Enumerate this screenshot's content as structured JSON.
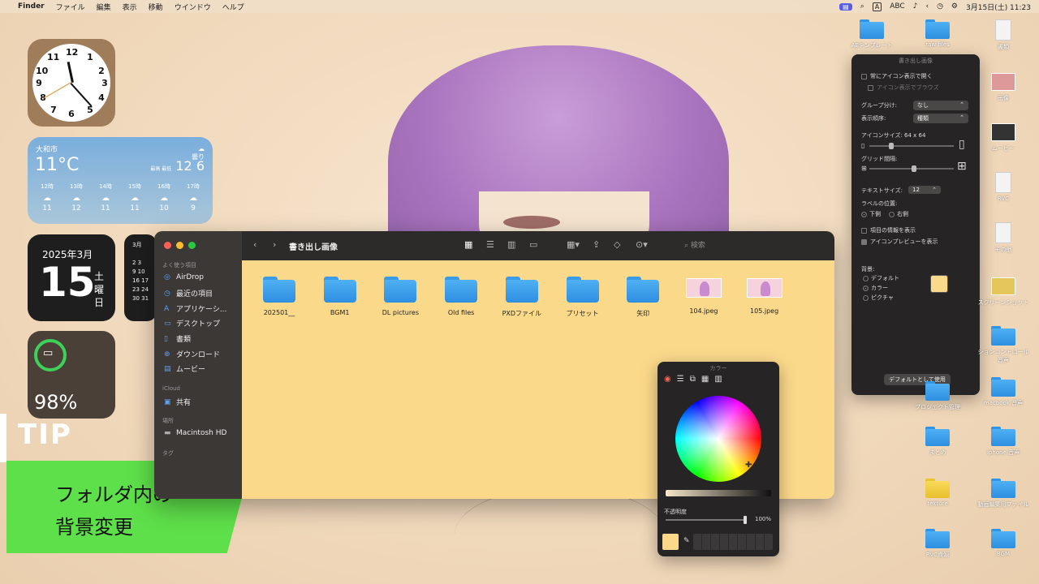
{
  "menubar": {
    "app": "Finder",
    "items": [
      "ファイル",
      "編集",
      "表示",
      "移動",
      "ウインドウ",
      "ヘルプ"
    ],
    "input_abc": "ABC",
    "input_a": "A",
    "datetime": "3月15日(土) 11:23"
  },
  "weather": {
    "city": "大和市",
    "temp": "11°C",
    "cond": "曇り",
    "hilo_label": "最高 最低",
    "hilo": "12 6",
    "hours": [
      {
        "h": "12時",
        "t": "11"
      },
      {
        "h": "13時",
        "t": "12"
      },
      {
        "h": "14時",
        "t": "11"
      },
      {
        "h": "15時",
        "t": "11"
      },
      {
        "h": "16時",
        "t": "10"
      },
      {
        "h": "17時",
        "t": "9"
      }
    ]
  },
  "date_widget": {
    "ym": "2025年3月",
    "day": "15",
    "weekday": "土曜日"
  },
  "cal_widget": {
    "month": "3月",
    "rows": [
      "",
      "2 3",
      "9 10",
      "16 17",
      "23 24",
      "30 31"
    ]
  },
  "battery": {
    "pct": "98%",
    "level": 0.98
  },
  "tip": {
    "label": "TIP",
    "line1": "フォルダ内の",
    "line2": "背景変更"
  },
  "finder": {
    "title": "書き出し画像",
    "search_placeholder": "検索",
    "sidebar": {
      "favorites_header": "よく使う項目",
      "favorites": [
        "AirDrop",
        "最近の項目",
        "アプリケーシ...",
        "デスクトップ",
        "書類",
        "ダウンロード",
        "ムービー"
      ],
      "icloud_header": "iCloud",
      "icloud": [
        "共有"
      ],
      "locations_header": "場所",
      "locations": [
        "Macintosh HD"
      ],
      "tags_header": "タグ"
    },
    "items": [
      {
        "name": "202501__",
        "kind": "folder"
      },
      {
        "name": "BGM1",
        "kind": "folder"
      },
      {
        "name": "DL pictures",
        "kind": "folder"
      },
      {
        "name": "Old files",
        "kind": "folder"
      },
      {
        "name": "PXDファイル",
        "kind": "folder"
      },
      {
        "name": "プリセット",
        "kind": "folder"
      },
      {
        "name": "矢印",
        "kind": "folder"
      },
      {
        "name": "104.jpeg",
        "kind": "image"
      },
      {
        "name": "105.jpeg",
        "kind": "image"
      }
    ],
    "bg_color": "#fbd98b"
  },
  "view_options": {
    "title": "書き出し画像",
    "always_icon": "常にアイコン表示で開く",
    "browse_icon": "アイコン表示でブラウズ",
    "group_label": "グループ分け:",
    "group_value": "なし",
    "sort_label": "表示順序:",
    "sort_value": "種類",
    "icon_size_label": "アイコンサイズ: 64 x 64",
    "grid_label": "グリッド間隔:",
    "text_size_label": "テキストサイズ:",
    "text_size_value": "12",
    "label_pos": "ラベルの位置:",
    "pos_bottom": "下側",
    "pos_right": "右側",
    "show_info": "項目の情報を表示",
    "show_preview": "アイコンプレビューを表示",
    "bg_label": "背景:",
    "bg_default": "デフォルト",
    "bg_color": "カラー",
    "bg_picture": "ピクチャ",
    "default_btn": "デフォルトとして使用"
  },
  "color_panel": {
    "title": "カラー",
    "opacity_label": "不透明度",
    "opacity_value": "100%"
  },
  "desktop": {
    "col1": [
      "AEテンプレート",
      "プロジェクト管理",
      "まとめ",
      "texture",
      "RVC資源"
    ],
    "col2": [
      "raw files",
      "macbook 音声",
      "iphone 音声",
      "動画編集用ファイル",
      "BGM"
    ],
    "col3": [
      "書類",
      "画像",
      "ムービー",
      "RVC",
      "その他",
      "スクリーンショット",
      "ションコントロール音声"
    ]
  }
}
